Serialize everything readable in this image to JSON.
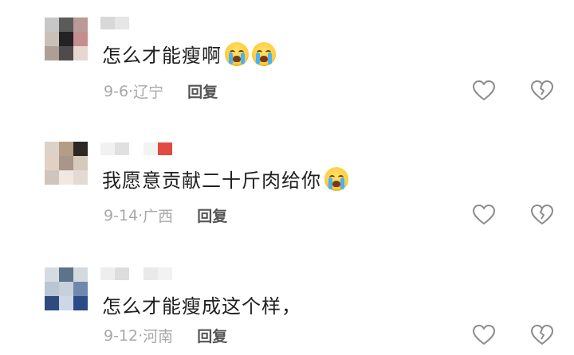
{
  "comments": [
    {
      "text": "怎么才能瘦啊",
      "emojis": [
        "crying-face",
        "crying-face"
      ],
      "date": "9-6",
      "location": "辽宁",
      "reply_label": "回复",
      "avatar_colors": [
        "#c7c7c7",
        "#5b5b5b",
        "#b99a96",
        "#c9c1b9",
        "#232323",
        "#c68d8d",
        "#ad9f97",
        "#504a4a",
        "#e7d7d2"
      ],
      "username_colors": [
        "#d8d8d8",
        "#e6e6e6",
        "#ffffff"
      ]
    },
    {
      "text": "我愿意贡献二十斤肉给你",
      "emojis": [
        "crying-face"
      ],
      "date": "9-14",
      "location": "广西",
      "reply_label": "回复",
      "avatar_colors": [
        "#dcd2c8",
        "#b49d86",
        "#2e2723",
        "#e2d1c3",
        "#a8968a",
        "#d6cabe",
        "#cfc5bc",
        "#f0e8e1",
        "#e3dbd3"
      ],
      "username_colors": [
        "#f1f1f1",
        "#e0e0e0",
        "#ffffff",
        "#f3f3f3",
        "#e04a43"
      ]
    },
    {
      "text": "怎么才能瘦成这个样，",
      "emojis": [],
      "date": "9-12",
      "location": "河南",
      "reply_label": "回复",
      "avatar_colors": [
        "#d6dbe3",
        "#5c7389",
        "#d4d9de",
        "#b9c6d4",
        "#c8d0dc",
        "#6e88ae",
        "#2f4a7d",
        "#cdd7e6",
        "#2b4b86"
      ],
      "username_colors": [
        "#eeeeee",
        "#dddddd",
        "#ffffff",
        "#e9e9e9",
        "#f2f2f2"
      ]
    }
  ],
  "separator": "·",
  "icons": {
    "like": "heart-outline-icon",
    "dislike": "broken-heart-outline-icon"
  },
  "colors": {
    "text": "#1f1f1f",
    "meta": "#a8a8a8",
    "reply": "#555555",
    "icon": "#8c8c8c"
  }
}
